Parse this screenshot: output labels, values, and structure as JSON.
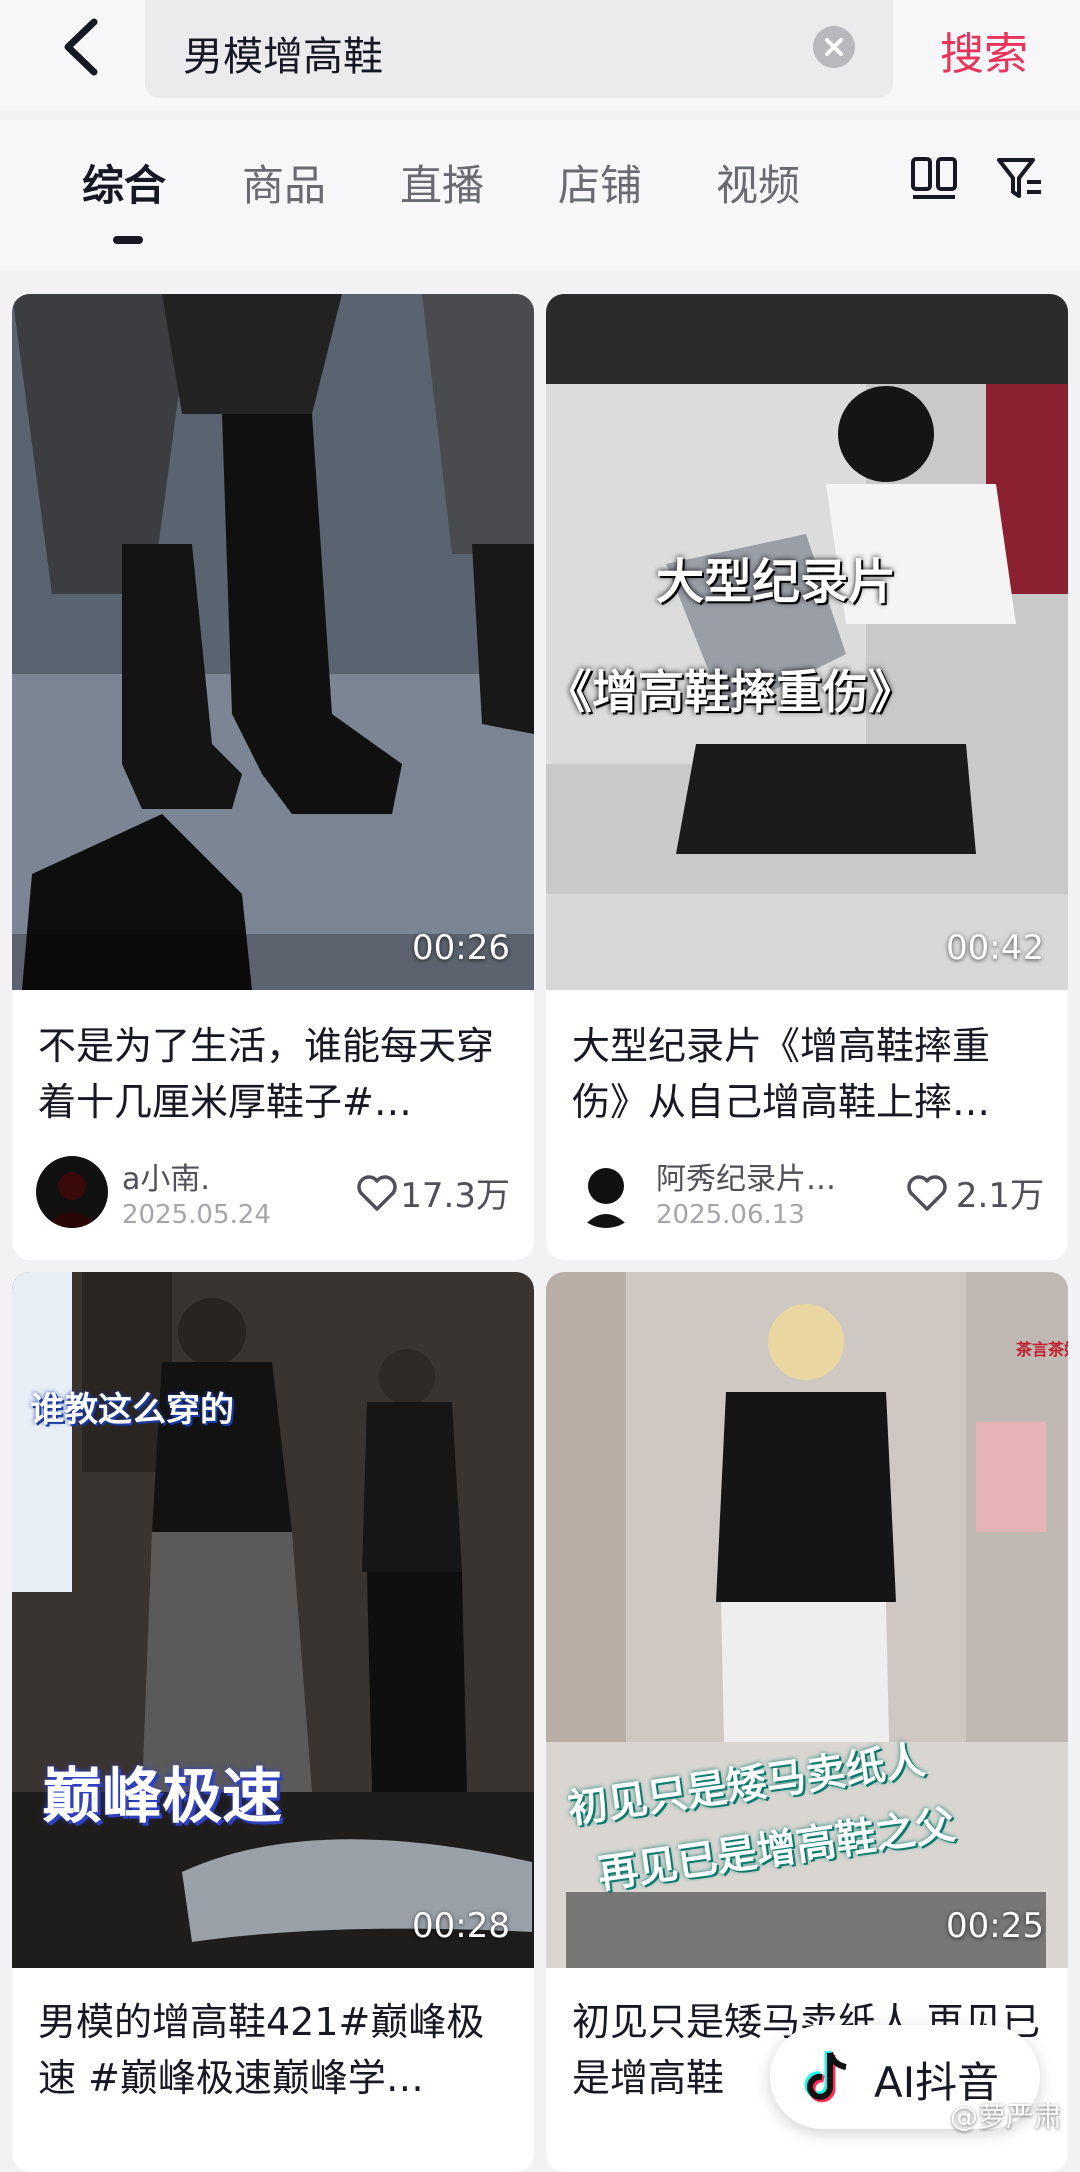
{
  "search": {
    "query": "男模增高鞋",
    "button": "搜索"
  },
  "tabs": [
    {
      "label": "综合",
      "active": true
    },
    {
      "label": "商品"
    },
    {
      "label": "直播"
    },
    {
      "label": "店铺"
    },
    {
      "label": "视频"
    }
  ],
  "cards": [
    {
      "duration": "00:26",
      "title": "不是为了生活，谁能每天穿着十几厘米厚鞋子#…",
      "author": "a小南.",
      "date": "2025.05.24",
      "likes": "17.3万"
    },
    {
      "duration": "00:42",
      "overlay_1": "大型纪录片",
      "overlay_2": "《增高鞋摔重伤》",
      "title": "大型纪录片《增高鞋摔重伤》从自己增高鞋上摔…",
      "author": "阿秀纪录片…",
      "date": "2025.06.13",
      "likes": "2.1万"
    },
    {
      "duration": "00:28",
      "overlay_1": "谁教这么穿的",
      "overlay_2": "巅峰极速",
      "title": "男模的增高鞋421#巅峰极速 #巅峰极速巅峰学…"
    },
    {
      "duration": "00:25",
      "overlay_1": "初见只是矮马卖纸人",
      "overlay_2": "再见已是增高鞋之父",
      "overlay_3": "茶言茶娱",
      "title": "初见只是矮马卖纸人 再见已是增高鞋"
    }
  ],
  "ai_button": {
    "label": "AI抖音"
  },
  "watermark": "@萝严肃"
}
